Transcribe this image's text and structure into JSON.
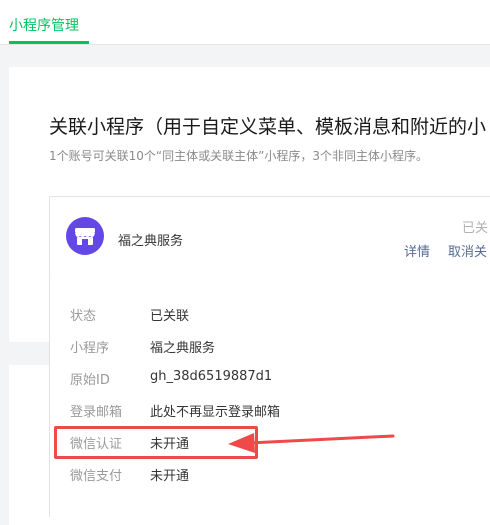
{
  "tabs": {
    "active_label": "小程序管理"
  },
  "section": {
    "title": "关联小程序（用于自定义菜单、模板消息和附近的小",
    "subtitle": "1个账号可关联10个“同主体或关联主体”小程序，3个非同主体小程序。"
  },
  "linked_app": {
    "name": "福之典服务",
    "status": "已关",
    "detail_link": "详情",
    "unlink_link": "取消关"
  },
  "details": [
    {
      "label": "状态",
      "value": "已关联"
    },
    {
      "label": "小程序",
      "value": "福之典服务"
    },
    {
      "label": "原始ID",
      "value": "gh_38d6519887d1"
    },
    {
      "label": "登录邮箱",
      "value": "此处不再显示登录邮箱"
    },
    {
      "label": "微信认证",
      "value": "未开通"
    },
    {
      "label": "微信支付",
      "value": "未开通"
    }
  ],
  "colors": {
    "accent": "#07c160",
    "link": "#576b95",
    "annotation": "#ee4a4a",
    "logo": "#6448e6"
  },
  "icons": {
    "app_logo": "shop-store-icon"
  }
}
